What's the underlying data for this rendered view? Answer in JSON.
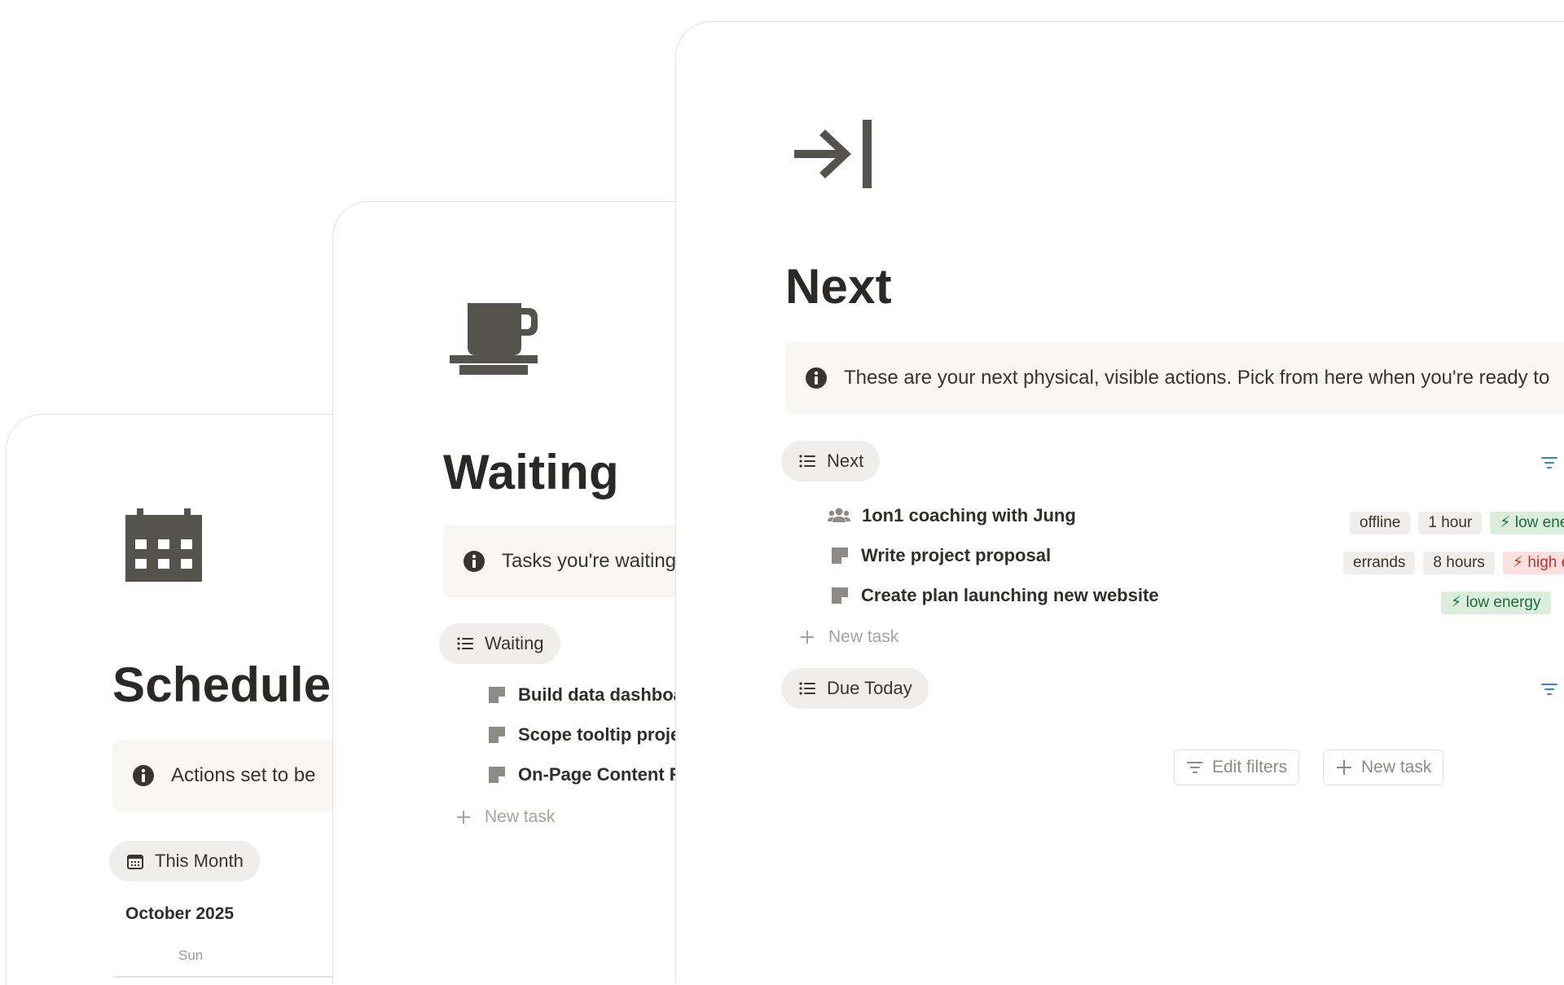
{
  "colors": {
    "icon_gray": "#55534e",
    "callout_bg": "#f7f6f3",
    "tab_bg": "#efeeec",
    "filter_blue": "#2f80ed",
    "tag_green_bg": "#dbeddb",
    "tag_red_bg": "#fbe0df"
  },
  "schedule": {
    "icon": "calendar-icon",
    "title": "Schedule",
    "callout": "Actions set to be",
    "view_tab": "This Month",
    "month": "October 2025",
    "weekday": "Sun"
  },
  "waiting": {
    "icon": "coffee-cup-icon",
    "title": "Waiting",
    "callout": "Tasks you're waiting",
    "view_tab": "Waiting",
    "tasks": [
      {
        "name": "Build data dashboa"
      },
      {
        "name": "Scope tooltip proje"
      },
      {
        "name": "On-Page Content R"
      }
    ],
    "new_task": "New task"
  },
  "next": {
    "icon": "arrow-to-bar-icon",
    "title": "Next",
    "callout": "These are your next physical, visible actions. Pick from here when you're ready to",
    "view_tab": "Next",
    "tasks": [
      {
        "name": "1on1 coaching with Jung",
        "icon": "people-icon",
        "tags": [
          "offline",
          "1 hour",
          "⚡ low energy"
        ]
      },
      {
        "name": "Write project proposal",
        "icon": "page-icon",
        "tags": [
          "errands",
          "8 hours",
          "⚡ high energy"
        ]
      },
      {
        "name": "Create plan launching new website",
        "icon": "page-icon",
        "tags": [
          "⚡ low energy"
        ]
      }
    ],
    "new_task": "New task",
    "second_view_tab": "Due Today",
    "edit_filters": "Edit filters",
    "new_task_button": "New task"
  }
}
